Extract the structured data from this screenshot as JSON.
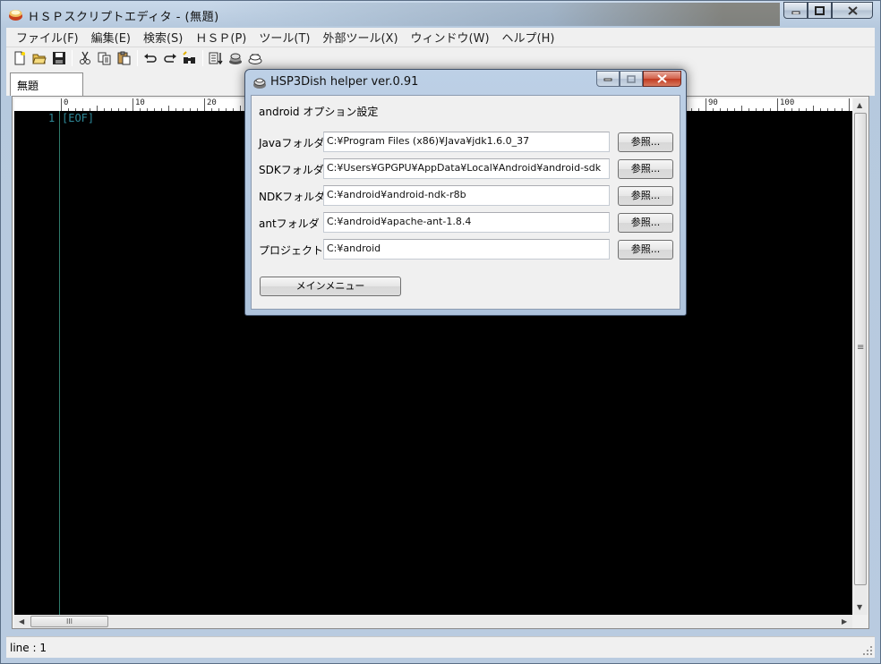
{
  "window": {
    "title": "ＨＳＰスクリプトエディタ - (無題)"
  },
  "menu": [
    "ファイル(F)",
    "編集(E)",
    "検索(S)",
    "ＨＳＰ(P)",
    "ツール(T)",
    "外部ツール(X)",
    "ウィンドウ(W)",
    "ヘルプ(H)"
  ],
  "toolbar": {
    "icons": [
      "new-file-icon",
      "open-folder-icon",
      "save-icon",
      "cut-icon",
      "copy-icon",
      "paste-icon",
      "undo-icon",
      "redo-icon",
      "find-icon",
      "compile-icon",
      "run-icon",
      "build-icon"
    ]
  },
  "tabs": [
    {
      "label": "無題"
    }
  ],
  "editor": {
    "ruler_marks": [
      "0",
      "10",
      "20",
      "90",
      "100"
    ],
    "line_number": "1",
    "eof": "[EOF]"
  },
  "scroll": {
    "h_thumb": "III",
    "v_thumb": "≡"
  },
  "status": {
    "line": "line : 1"
  },
  "dialog": {
    "title": "HSP3Dish helper ver.0.91",
    "heading": "android オプション設定",
    "rows": [
      {
        "label": "Javaフォルダ",
        "value": "C:¥Program Files (x86)¥Java¥jdk1.6.0_37",
        "button": "参照..."
      },
      {
        "label": "SDKフォルダ",
        "value": "C:¥Users¥GPGPU¥AppData¥Local¥Android¥android-sdk",
        "button": "参照..."
      },
      {
        "label": "NDKフォルダ",
        "value": "C:¥android¥android-ndk-r8b",
        "button": "参照..."
      },
      {
        "label": "antフォルダ",
        "value": "C:¥android¥apache-ant-1.8.4",
        "button": "参照..."
      },
      {
        "label": "プロジェクト",
        "value": "C:¥android",
        "button": "参照..."
      }
    ],
    "main_menu_button": "メインメニュー"
  }
}
